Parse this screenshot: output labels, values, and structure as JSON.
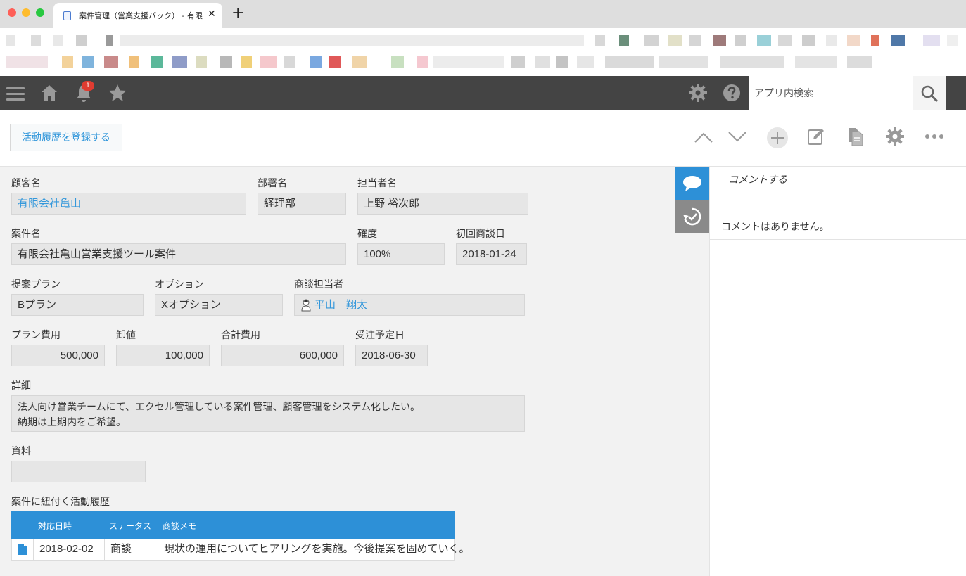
{
  "browser": {
    "tab_title": "案件管理（営業支援パック） - 有限",
    "close_glyph": "✕",
    "new_tab_glyph": "+"
  },
  "header": {
    "notification_count": "1",
    "search_placeholder": "アプリ内検索"
  },
  "toolbar": {
    "register_label": "活動履歴を登録する"
  },
  "record": {
    "customer_label": "顧客名",
    "customer_value": "有限会社亀山",
    "department_label": "部署名",
    "department_value": "経理部",
    "contact_label": "担当者名",
    "contact_value": "上野 裕次郎",
    "deal_label": "案件名",
    "deal_value": "有限会社亀山営業支援ツール案件",
    "probability_label": "確度",
    "probability_value": "100%",
    "first_meeting_label": "初回商談日",
    "first_meeting_value": "2018-01-24",
    "plan_label": "提案プラン",
    "plan_value": "Bプラン",
    "option_label": "オプション",
    "option_value": "Xオプション",
    "rep_label": "商談担当者",
    "rep_value": "平山　翔太",
    "plan_cost_label": "プラン費用",
    "plan_cost_value": "500,000",
    "wholesale_label": "卸値",
    "wholesale_value": "100,000",
    "total_label": "合計費用",
    "total_value": "600,000",
    "order_date_label": "受注予定日",
    "order_date_value": "2018-06-30",
    "detail_label": "詳細",
    "detail_line1": "法人向け営業チームにて、エクセル管理している案件管理、顧客管理をシステム化したい。",
    "detail_line2": "納期は上期内をご希望。",
    "materials_label": "資料",
    "activity_label": "案件に紐付く活動履歴"
  },
  "activity_table": {
    "headers": [
      "対応日時",
      "ステータス",
      "商談メモ"
    ],
    "rows": [
      {
        "date": "2018-02-02",
        "status": "商談",
        "memo": "現状の運用についてヒアリングを実施。今後提案を固めていく。"
      }
    ]
  },
  "comments": {
    "placeholder": "コメントする",
    "empty_message": "コメントはありません。"
  },
  "colors": {
    "accent": "#2d90d7",
    "link": "#3498db",
    "appbar": "#444444",
    "badge": "#e03c31"
  },
  "icons": [
    "menu-icon",
    "home-icon",
    "bell-icon",
    "star-icon",
    "gear-icon",
    "help-icon",
    "search-icon",
    "chevron-up-icon",
    "chevron-down-icon",
    "plus-icon",
    "edit-icon",
    "copy-icon",
    "more-icon",
    "comment-icon",
    "history-icon",
    "document-icon",
    "user-icon"
  ]
}
